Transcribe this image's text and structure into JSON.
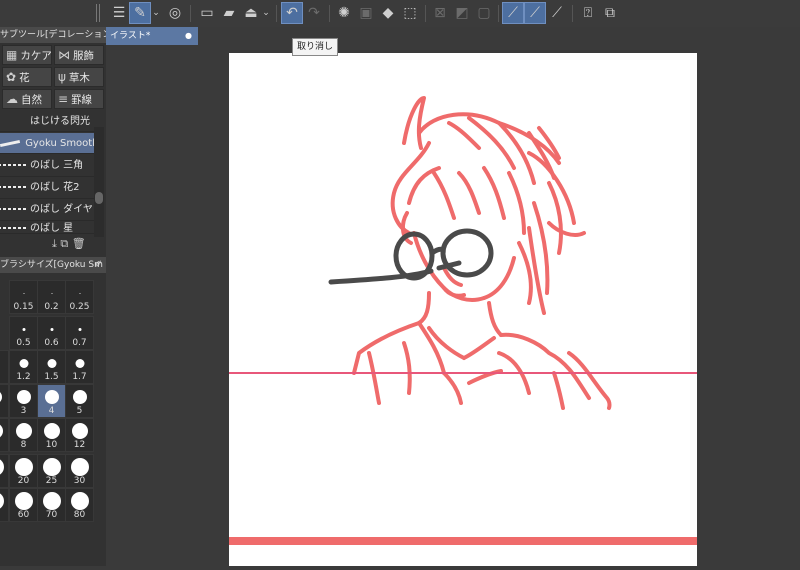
{
  "tooltip": "取り消し",
  "document_tab": {
    "title": "イラスト*",
    "close": "●"
  },
  "sub_tool_panel": {
    "title": "サブツール[デコレーション]",
    "categories": [
      {
        "label": "カケア",
        "icon": "cross-pattern-icon"
      },
      {
        "label": "服飾",
        "icon": "ribbon-icon"
      },
      {
        "label": "花",
        "icon": "flower-icon"
      },
      {
        "label": "草木",
        "icon": "grass-icon"
      },
      {
        "label": "自然",
        "icon": "cloud-icon"
      },
      {
        "label": "罫線",
        "icon": "ruled-lines-icon"
      }
    ],
    "brushes": [
      "はじける閃光",
      "Gyoku Smooth",
      "のばし 三角",
      "のばし 花2",
      "のばし ダイヤ",
      "のばし 星"
    ]
  },
  "brush_size_panel": {
    "title": "ブラシサイズ[Gyoku Sm",
    "sizes": [
      "0.15",
      "0.2",
      "0.25",
      "0.5",
      "0.6",
      "0.7",
      "1.2",
      "1.5",
      "1.7",
      "3",
      "4",
      "5",
      "8",
      "10",
      "12",
      "20",
      "25",
      "30",
      "60",
      "70",
      "80"
    ],
    "selected": "4"
  },
  "colors": {
    "accent": "#5a6f94",
    "sketch": "#ef6b6b",
    "guide_line": "#e8577a",
    "glasses": "#4a4a4a"
  }
}
